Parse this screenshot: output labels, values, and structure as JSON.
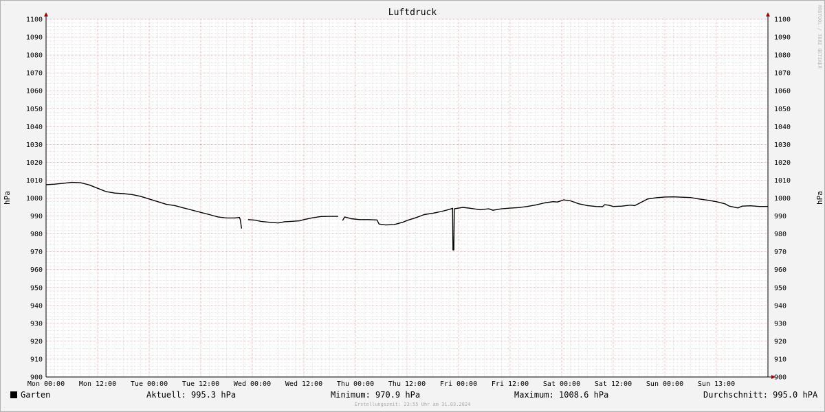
{
  "chart_data": {
    "type": "line",
    "title": "Luftdruck",
    "ylabel": "hPa",
    "ylim": [
      900,
      1100
    ],
    "yticks": [
      900,
      910,
      920,
      930,
      940,
      950,
      960,
      970,
      980,
      990,
      1000,
      1010,
      1020,
      1030,
      1040,
      1050,
      1060,
      1070,
      1080,
      1090,
      1100
    ],
    "xlim_hours": [
      0,
      168
    ],
    "xticks": [
      {
        "h": 0,
        "label": "Mon 00:00"
      },
      {
        "h": 12,
        "label": "Mon 12:00"
      },
      {
        "h": 24,
        "label": "Tue 00:00"
      },
      {
        "h": 36,
        "label": "Tue 12:00"
      },
      {
        "h": 48,
        "label": "Wed 00:00"
      },
      {
        "h": 60,
        "label": "Wed 12:00"
      },
      {
        "h": 72,
        "label": "Thu 00:00"
      },
      {
        "h": 84,
        "label": "Thu 12:00"
      },
      {
        "h": 96,
        "label": "Fri 00:00"
      },
      {
        "h": 108,
        "label": "Fri 12:00"
      },
      {
        "h": 120,
        "label": "Sat 00:00"
      },
      {
        "h": 132,
        "label": "Sat 12:00"
      },
      {
        "h": 144,
        "label": "Sun 00:00"
      },
      {
        "h": 156,
        "label": "Sun 13:00"
      }
    ],
    "series": [
      {
        "name": "Garten",
        "color": "#000000",
        "segments": [
          [
            [
              0,
              1007.5
            ],
            [
              2,
              1007.8
            ],
            [
              4,
              1008.3
            ],
            [
              6,
              1008.8
            ],
            [
              8,
              1008.6
            ],
            [
              10,
              1007.4
            ],
            [
              12,
              1005.5
            ],
            [
              14,
              1003.6
            ],
            [
              16,
              1002.8
            ],
            [
              18,
              1002.5
            ],
            [
              20,
              1002.0
            ],
            [
              22,
              1001.0
            ],
            [
              24,
              999.5
            ],
            [
              26,
              998.0
            ],
            [
              28,
              996.5
            ],
            [
              30,
              995.8
            ],
            [
              32,
              994.5
            ],
            [
              34,
              993.3
            ],
            [
              36,
              992.0
            ],
            [
              38,
              990.8
            ],
            [
              40,
              989.5
            ],
            [
              42,
              988.9
            ],
            [
              44,
              988.9
            ],
            [
              45,
              989.2
            ],
            [
              45.2,
              987.9
            ],
            [
              45.5,
              983.0
            ]
          ],
          [
            [
              47,
              988.0
            ],
            [
              48.5,
              987.7
            ],
            [
              50,
              987.0
            ],
            [
              52,
              986.5
            ],
            [
              54,
              986.1
            ],
            [
              55.5,
              986.8
            ],
            [
              57,
              987.0
            ],
            [
              59,
              987.3
            ],
            [
              60,
              988.0
            ],
            [
              62,
              989.0
            ],
            [
              64,
              989.7
            ],
            [
              66,
              989.8
            ],
            [
              68,
              989.8
            ]
          ],
          [
            [
              69,
              987.5
            ],
            [
              69.5,
              989.5
            ],
            [
              71,
              988.5
            ],
            [
              73,
              988.0
            ],
            [
              75,
              988.0
            ],
            [
              77,
              987.8
            ],
            [
              77.5,
              985.5
            ],
            [
              79,
              985.0
            ],
            [
              81,
              985.2
            ],
            [
              83,
              986.5
            ],
            [
              84,
              987.5
            ],
            [
              86,
              989.0
            ],
            [
              88,
              990.8
            ],
            [
              90,
              991.5
            ],
            [
              92,
              992.5
            ],
            [
              94,
              993.8
            ],
            [
              94.6,
              994.3
            ],
            [
              94.7,
              971.0
            ],
            [
              94.9,
              971.0
            ],
            [
              95,
              994.0
            ],
            [
              97,
              994.8
            ],
            [
              99,
              994.2
            ],
            [
              101,
              993.5
            ],
            [
              103,
              994.0
            ],
            [
              104,
              993.2
            ],
            [
              106,
              994.0
            ],
            [
              108,
              994.4
            ],
            [
              110,
              994.7
            ],
            [
              112,
              995.3
            ],
            [
              114,
              996.2
            ],
            [
              116,
              997.3
            ],
            [
              118,
              998.0
            ],
            [
              119,
              997.8
            ],
            [
              120.5,
              999.0
            ],
            [
              122,
              998.5
            ],
            [
              124,
              996.8
            ],
            [
              126,
              995.8
            ],
            [
              128,
              995.3
            ],
            [
              129.5,
              995.2
            ],
            [
              130,
              996.3
            ],
            [
              131,
              996.0
            ],
            [
              132,
              995.3
            ],
            [
              134,
              995.5
            ],
            [
              136,
              996.1
            ],
            [
              137,
              995.8
            ],
            [
              138,
              997.0
            ],
            [
              140,
              999.5
            ],
            [
              142,
              1000.2
            ],
            [
              144,
              1000.6
            ],
            [
              146,
              1000.7
            ],
            [
              148,
              1000.5
            ],
            [
              150,
              1000.3
            ],
            [
              152,
              999.5
            ],
            [
              154,
              998.8
            ],
            [
              156,
              998.0
            ],
            [
              158,
              996.8
            ],
            [
              159,
              995.5
            ],
            [
              161,
              994.5
            ],
            [
              162,
              995.5
            ],
            [
              164,
              995.7
            ],
            [
              166,
              995.3
            ],
            [
              168,
              995.3
            ]
          ]
        ]
      }
    ]
  },
  "legend": {
    "series_label": "Garten",
    "aktuell": "Aktuell: 995.3 hPa",
    "minimum": "Minimum: 970.9 hPa",
    "maximum": "Maximum: 1008.6 hPa",
    "durchschnitt": "Durchschnitt: 995.0 hPA"
  },
  "footer": "Erstellungszeit: 23:55 Uhr am 31.03.2024",
  "watermark": "RRDTOOL / TOBI OETIKER",
  "colors": {
    "grid_major": "#e8a0a0",
    "grid_minor": "#d0d0d0",
    "plot_bg": "#ffffff",
    "page_bg": "#f3f3f3",
    "arrow": "#a00000"
  }
}
